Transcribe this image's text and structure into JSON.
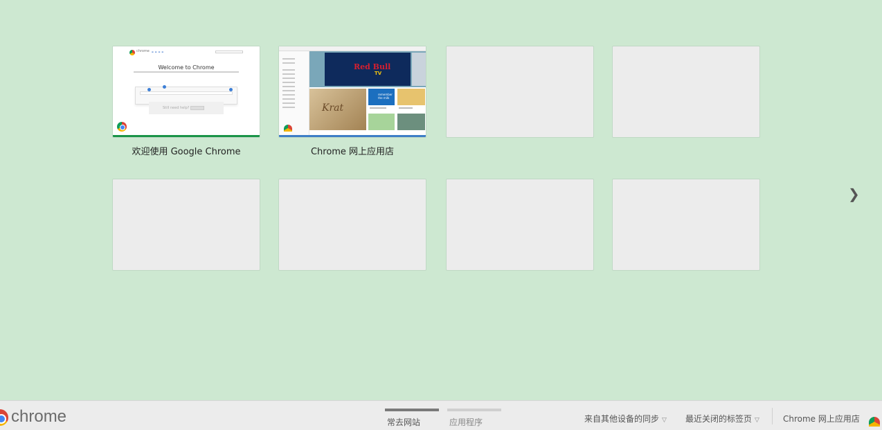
{
  "tiles": [
    {
      "label": "欢迎使用 Google Chrome",
      "thumb": "welcome"
    },
    {
      "label": "Chrome 网上应用店",
      "thumb": "store"
    },
    {
      "label": ""
    },
    {
      "label": ""
    },
    {
      "label": ""
    },
    {
      "label": ""
    },
    {
      "label": ""
    },
    {
      "label": ""
    }
  ],
  "welcome_thumb": {
    "logo_text": "chrome",
    "title": "Welcome to Chrome",
    "help_text": "Still need help?"
  },
  "store_thumb": {
    "feature_title": "Red Bull",
    "feature_sub": "TV",
    "app1_title": "Krat",
    "app2_title": "remember the milk"
  },
  "next_arrow": "❯",
  "footer": {
    "brand": "chrome",
    "pager": [
      {
        "label": "常去网站",
        "active": true
      },
      {
        "label": "应用程序",
        "active": false
      }
    ],
    "other_devices": "来自其他设备的同步",
    "recently_closed": "最近关闭的标签页",
    "web_store": "Chrome 网上应用店"
  },
  "colors": {
    "background": "#cde8d1",
    "footer": "#ececec",
    "pager_active": "#7a7a7a",
    "pager_inactive": "#cfcfcf"
  }
}
